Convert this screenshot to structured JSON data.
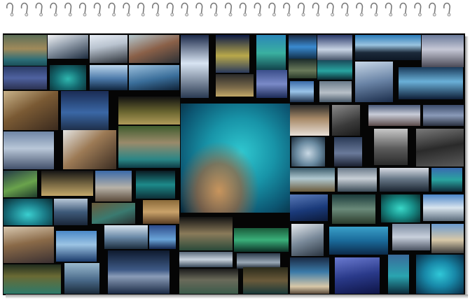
{
  "collage": {
    "description_alt": ""
  },
  "colors": {
    "frame": "#050505",
    "paper": "#ffffff",
    "ring": "#7a7a7a"
  }
}
